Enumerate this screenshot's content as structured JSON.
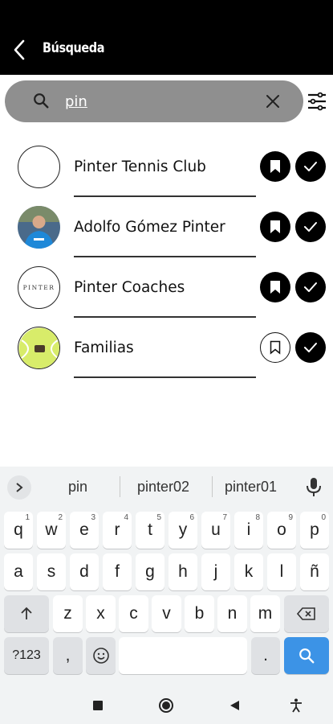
{
  "header": {
    "title": "Búsqueda",
    "back_icon": "chevron-left-icon"
  },
  "search": {
    "value": "pin",
    "search_icon": "search-icon",
    "clear_icon": "close-icon"
  },
  "filter": {
    "icon": "filter-lines-icon"
  },
  "results": [
    {
      "name": "Pinter Tennis Club",
      "avatar": "blank",
      "bookmarked": true,
      "followed": true
    },
    {
      "name": "Adolfo Gómez Pinter",
      "avatar": "person-photo",
      "bookmarked": true,
      "followed": true
    },
    {
      "name": "Pinter Coaches",
      "avatar": "pinter-logo",
      "avatar_text": "PINTER",
      "bookmarked": true,
      "followed": true
    },
    {
      "name": "Familias",
      "avatar": "tennis-ball",
      "bookmarked": false,
      "followed": true
    }
  ],
  "keyboard": {
    "suggestions": [
      "pin",
      "pinter02",
      "pinter01"
    ],
    "row1": [
      {
        "k": "q",
        "s": "1"
      },
      {
        "k": "w",
        "s": "2"
      },
      {
        "k": "e",
        "s": "3"
      },
      {
        "k": "r",
        "s": "4"
      },
      {
        "k": "t",
        "s": "5"
      },
      {
        "k": "y",
        "s": "6"
      },
      {
        "k": "u",
        "s": "7"
      },
      {
        "k": "i",
        "s": "8"
      },
      {
        "k": "o",
        "s": "9"
      },
      {
        "k": "p",
        "s": "0"
      }
    ],
    "row2": [
      "a",
      "s",
      "d",
      "f",
      "g",
      "h",
      "j",
      "k",
      "l",
      "ñ"
    ],
    "row3": [
      "z",
      "x",
      "c",
      "v",
      "b",
      "n",
      "m"
    ],
    "symbols_label": "?123",
    "comma": ",",
    "period": "."
  },
  "colors": {
    "header_bg": "#000000",
    "search_bg": "#8f8f8f",
    "keyboard_bg": "#f1f3f4",
    "search_key": "#3c93e6"
  }
}
